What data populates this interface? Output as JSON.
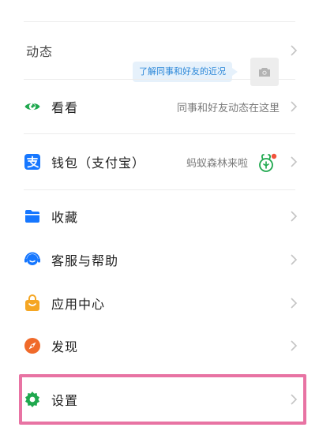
{
  "moments": {
    "label": "动态",
    "bubble_text": "了解同事和好友的近况",
    "camera_icon": "camera-icon"
  },
  "menu": [
    {
      "id": "kankan",
      "label": "看看",
      "subtitle": "同事和好友动态在这里",
      "icon": "eye-icon",
      "color": "#1fa84e"
    },
    {
      "id": "wallet",
      "label": "钱包（支付宝）",
      "subtitle": "蚂蚁森林来啦",
      "icon": "alipay-icon",
      "color": "#1677ff"
    },
    {
      "id": "favorites",
      "label": "收藏",
      "icon": "folder-icon",
      "color": "#1677ff"
    },
    {
      "id": "support",
      "label": "客服与帮助",
      "icon": "headset-icon",
      "color": "#1677ff"
    },
    {
      "id": "app-center",
      "label": "应用中心",
      "icon": "shopping-bag-icon",
      "color": "#f5a623"
    },
    {
      "id": "discover",
      "label": "发现",
      "icon": "compass-icon",
      "color": "#f06a2a"
    },
    {
      "id": "settings",
      "label": "设置",
      "icon": "gear-icon",
      "color": "#1fa84e"
    }
  ],
  "colors": {
    "highlight_border": "#e873a3",
    "chevron": "#c4c4c4",
    "badge_dot": "#f0533c"
  }
}
